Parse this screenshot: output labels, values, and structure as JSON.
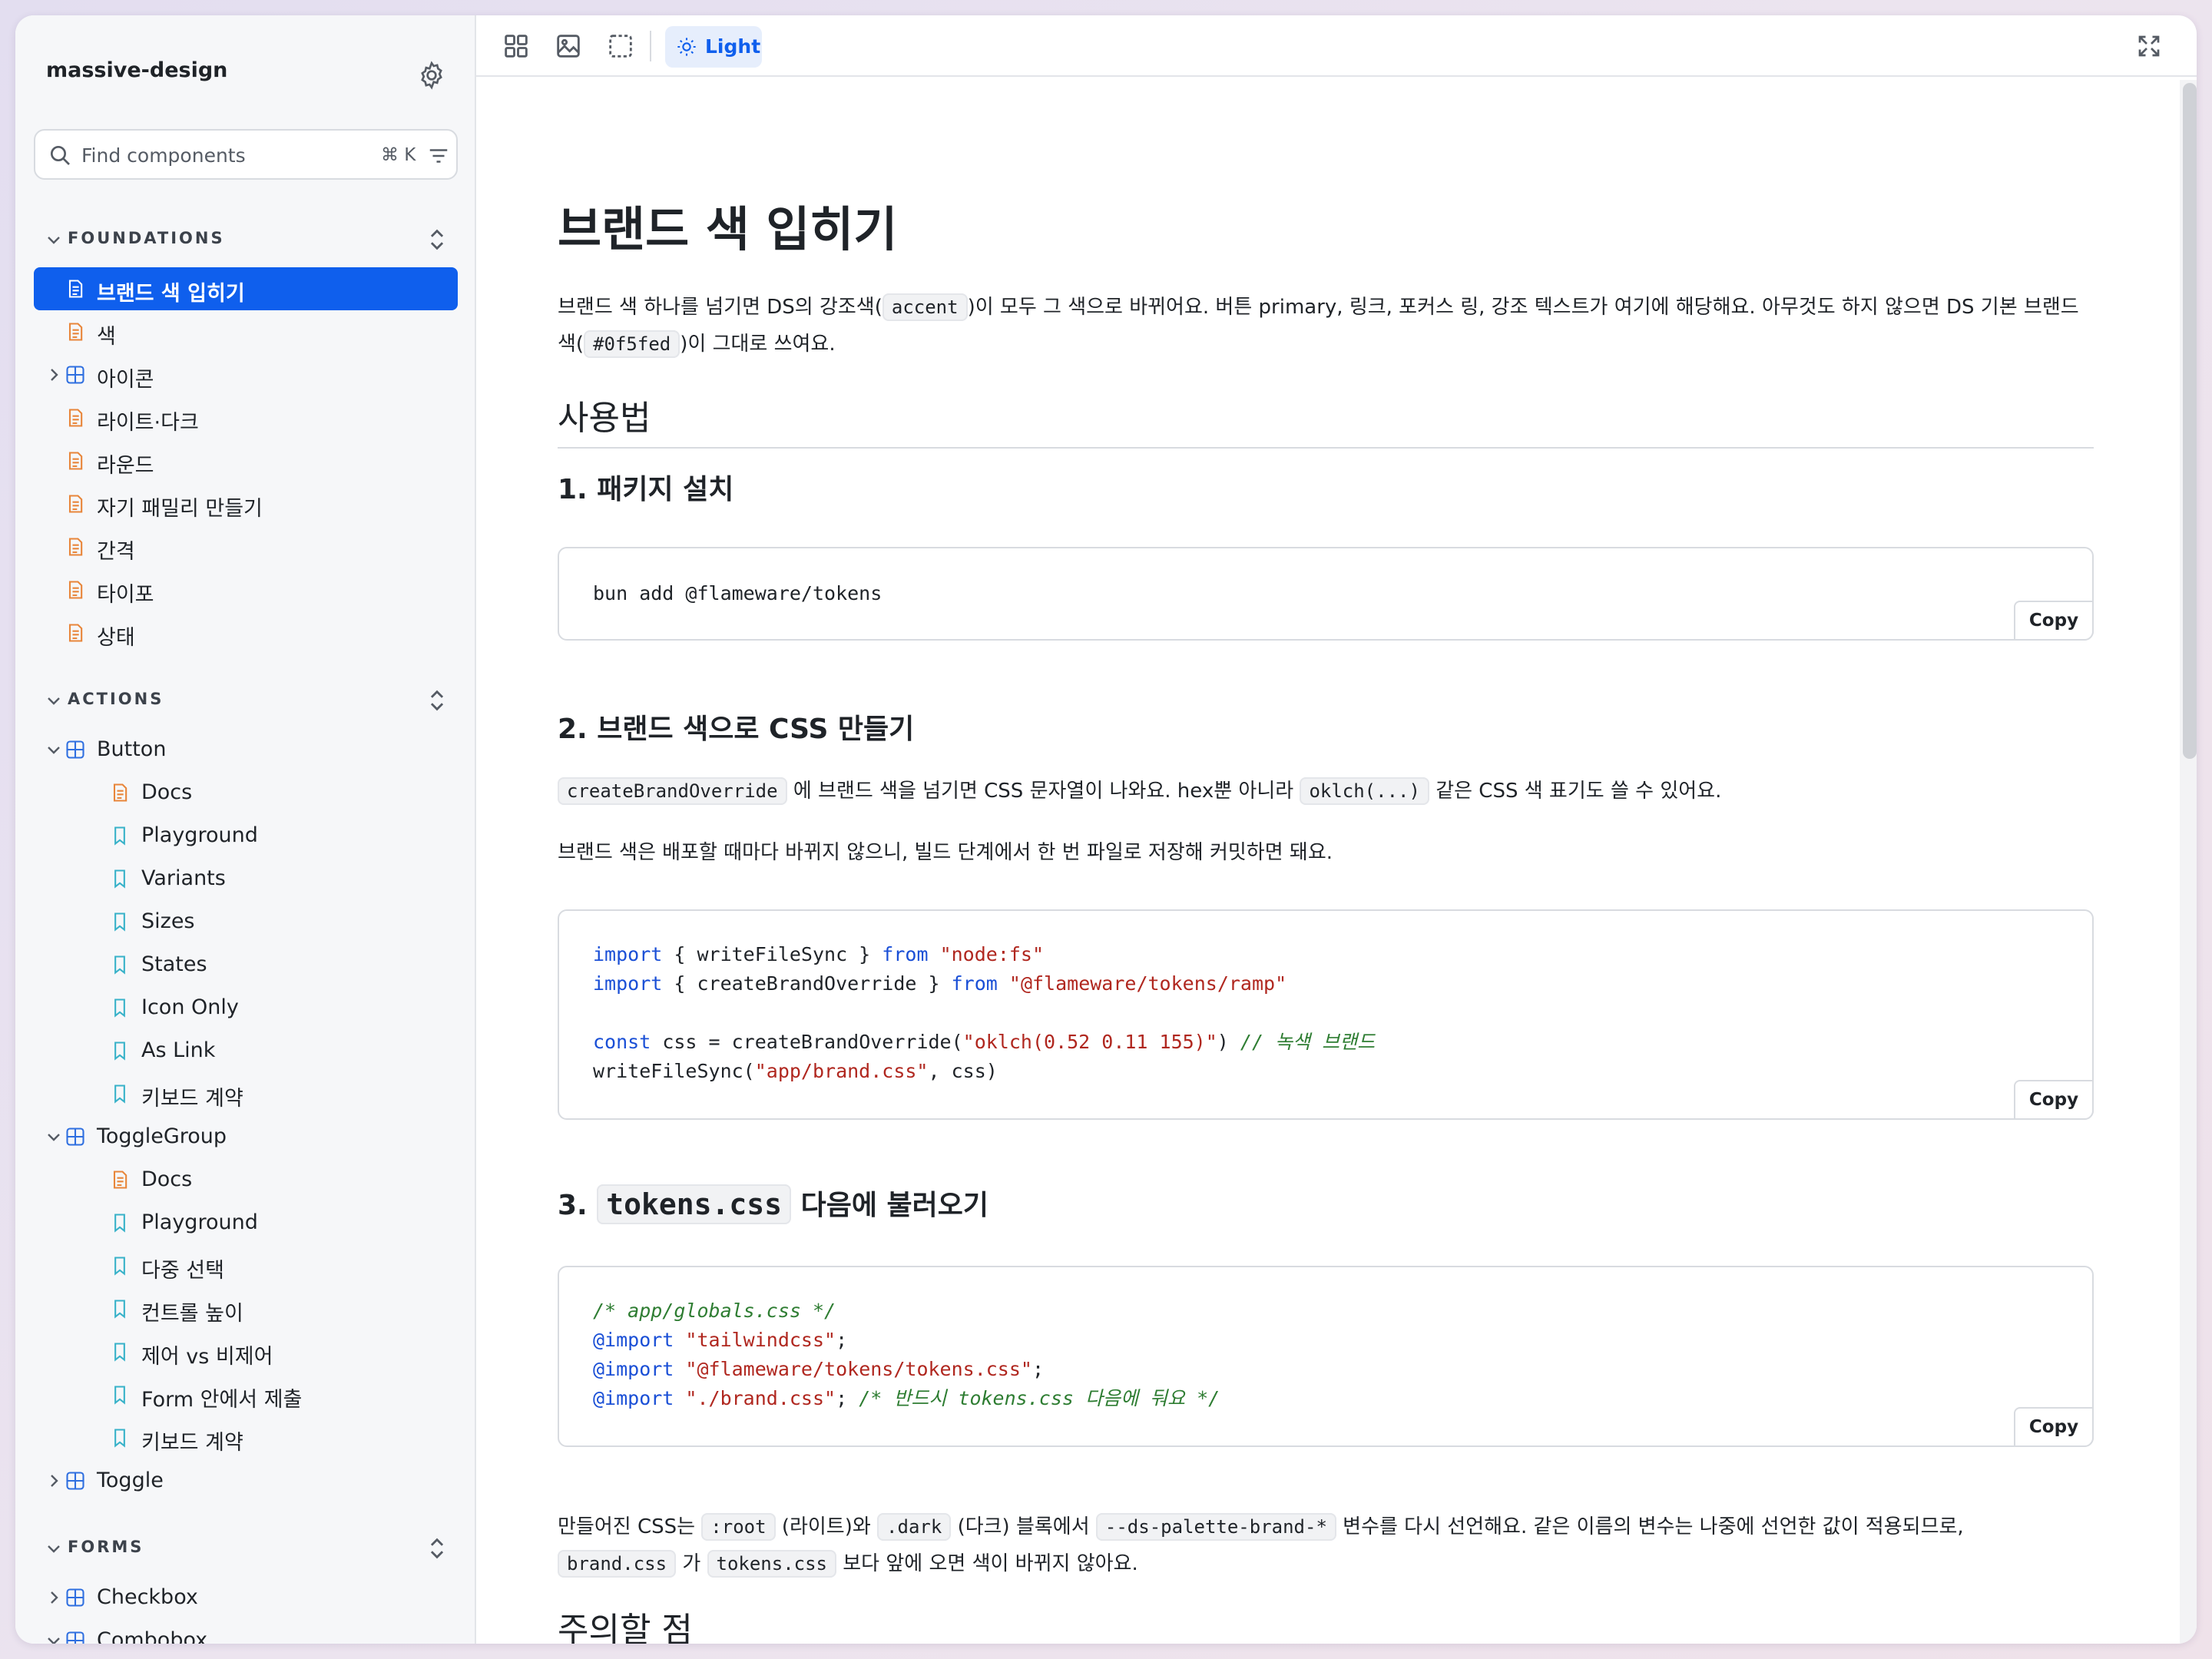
{
  "app": {
    "title": "massive-design"
  },
  "search": {
    "placeholder": "Find components",
    "shortcut": "⌘ K"
  },
  "sections": {
    "foundations": "FOUNDATIONS",
    "actions": "ACTIONS",
    "forms": "FORMS"
  },
  "sidebar_items": {
    "brand": "브랜드 색 입히기",
    "color": "색",
    "icons": "아이콘",
    "lightdark": "라이트·다크",
    "round": "라운드",
    "family": "자기 패밀리 만들기",
    "spacing": "간격",
    "typo": "타이포",
    "state": "상태",
    "button": "Button",
    "btn_docs": "Docs",
    "btn_playground": "Playground",
    "btn_variants": "Variants",
    "btn_sizes": "Sizes",
    "btn_states": "States",
    "btn_icononly": "Icon Only",
    "btn_aslink": "As Link",
    "btn_keyboard": "키보드 계약",
    "togglegroup": "ToggleGroup",
    "tg_docs": "Docs",
    "tg_playground": "Playground",
    "tg_multi": "다중 선택",
    "tg_height": "컨트롤 높이",
    "tg_controlled": "제어 vs 비제어",
    "tg_form": "Form 안에서 제출",
    "tg_keyboard": "키보드 계약",
    "toggle": "Toggle",
    "checkbox": "Checkbox",
    "combobox": "Combobox"
  },
  "toolbar": {
    "theme_label": "Light"
  },
  "doc": {
    "title": "브랜드 색 입히기",
    "intro_1a": "브랜드 색 하나를 넘기면 DS의 강조색(",
    "intro_1code": "accent",
    "intro_1b": ")이 모두 그 색으로 바뀌어요. 버튼 primary, 링크, 포커스 링, 강조 텍스트가 여기에 해당해요. 아무것도 하지 않으면 DS 기본 브랜드",
    "intro_2a": "색(",
    "intro_2code": "#0f5fed",
    "intro_2b": ")이 그대로 쓰여요.",
    "usage": "사용법",
    "step1": "1. 패키지 설치",
    "code1": "bun add @flameware/tokens",
    "step2": "2. 브랜드 색으로 CSS 만들기",
    "p2_code1": "createBrandOverride",
    "p2_a": "에 브랜드 색을 넘기면 CSS 문자열이 나와요. hex뿐 아니라",
    "p2_code2": "oklch(...)",
    "p2_b": "같은 CSS 색 표기도 쓸 수 있어요.",
    "p3": "브랜드 색은 배포할 때마다 바뀌지 않으니, 빌드 단계에서 한 번 파일로 저장해 커밋하면 돼요.",
    "code2": {
      "l1_kw": "import",
      "l1_a": " { writeFileSync } ",
      "l1_from": "from",
      "l1_str": "\"node:fs\"",
      "l2_kw": "import",
      "l2_a": " { createBrandOverride } ",
      "l2_from": "from",
      "l2_str": "\"@flameware/tokens/ramp\"",
      "l3_kw": "const",
      "l3_a": " css = createBrandOverride(",
      "l3_str": "\"oklch(0.52 0.11 155)\"",
      "l3_b": ") ",
      "l3_cm": "// 녹색 브랜드",
      "l4_a": "writeFileSync(",
      "l4_str": "\"app/brand.css\"",
      "l4_b": ", css)"
    },
    "step3_num": "3.",
    "step3_code": "tokens.css",
    "step3_text": "다음에 불러오기",
    "code3": {
      "l1_cm": "/* app/globals.css */",
      "l2_kw": "@import",
      "l2_str": "\"tailwindcss\"",
      "l2_b": ";",
      "l3_kw": "@import",
      "l3_str": "\"@flameware/tokens/tokens.css\"",
      "l3_b": ";",
      "l4_kw": "@import",
      "l4_str": "\"./brand.css\"",
      "l4_b": "; ",
      "l4_cm": "/* 반드시 tokens.css 다음에 둬요 */"
    },
    "p4_a": "만들어진 CSS는",
    "p4_c1": ":root",
    "p4_b": "(라이트)와",
    "p4_c2": ".dark",
    "p4_c": "(다크) 블록에서",
    "p4_c3": "--ds-palette-brand-*",
    "p4_d": "변수를 다시 선언해요. 같은 이름의 변수는 나중에 선언한 값이 적용되므로,",
    "p5_c1": "brand.css",
    "p5_a": "가",
    "p5_c2": "tokens.css",
    "p5_b": "보다 앞에 오면 색이 바뀌지 않아요.",
    "caution": "주의할 점",
    "copy_label": "Copy"
  },
  "colors": {
    "accent": "#0f5fed",
    "doc_icon": "#e8863a",
    "component_icon": "#2f6fe0",
    "story_icon": "#38b2c9"
  }
}
